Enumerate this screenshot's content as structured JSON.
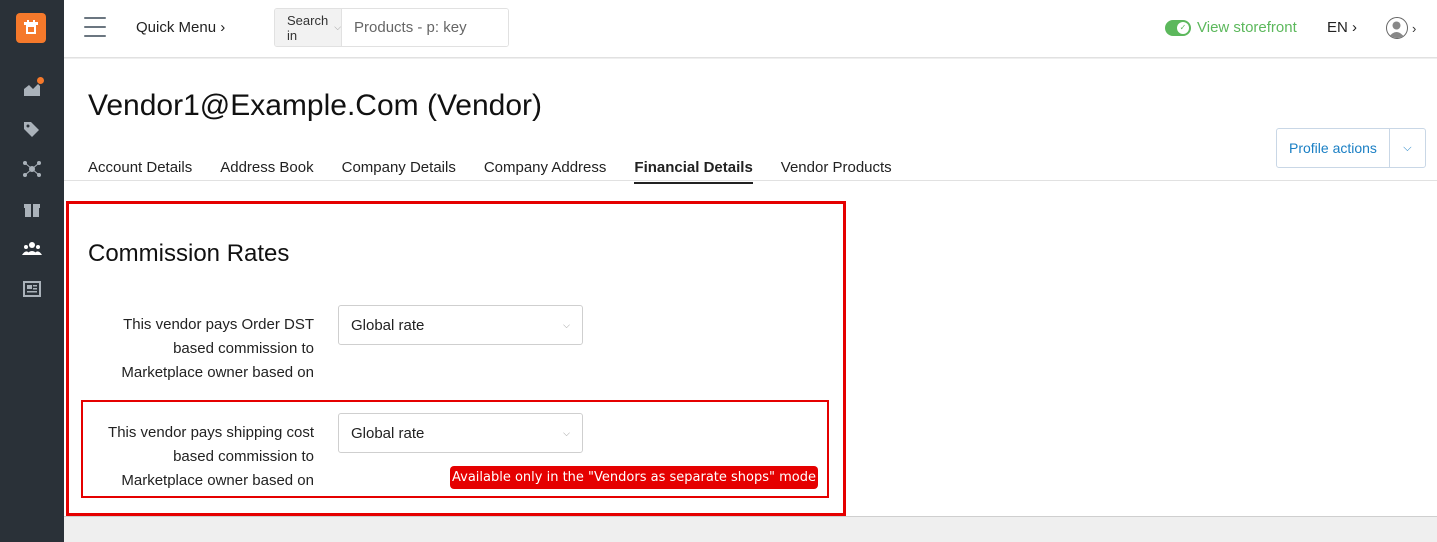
{
  "header": {
    "quick_menu": "Quick Menu ›",
    "search_in": "Search in",
    "search_placeholder": "Products - p: key",
    "view_storefront": "View storefront",
    "language": "EN ›",
    "user_chevron": "›"
  },
  "page": {
    "title": "Vendor1@Example.Com (Vendor)",
    "profile_actions": "Profile actions"
  },
  "tabs": [
    {
      "label": "Account Details"
    },
    {
      "label": "Address Book"
    },
    {
      "label": "Company Details"
    },
    {
      "label": "Company Address"
    },
    {
      "label": "Financial Details",
      "active": true
    },
    {
      "label": "Vendor Products"
    }
  ],
  "section": {
    "title": "Commission Rates",
    "fields": [
      {
        "label": "This vendor pays Order DST based commission to Marketplace owner based on",
        "value": "Global rate"
      },
      {
        "label": "This vendor pays shipping cost based commission to Marketplace owner based on",
        "value": "Global rate"
      }
    ],
    "notice": "Available only in the \"Vendors as separate shops\" mode"
  },
  "colors": {
    "sidebar": "#2a3138",
    "accent": "#f5792b",
    "storefront": "#5cb85c",
    "link": "#1a7fc4",
    "annotation": "#e50000"
  },
  "icons": [
    "logo-icon",
    "menu-icon",
    "dashboard-icon",
    "tags-icon",
    "network-icon",
    "gift-icon",
    "users-icon",
    "news-icon",
    "user-icon"
  ]
}
